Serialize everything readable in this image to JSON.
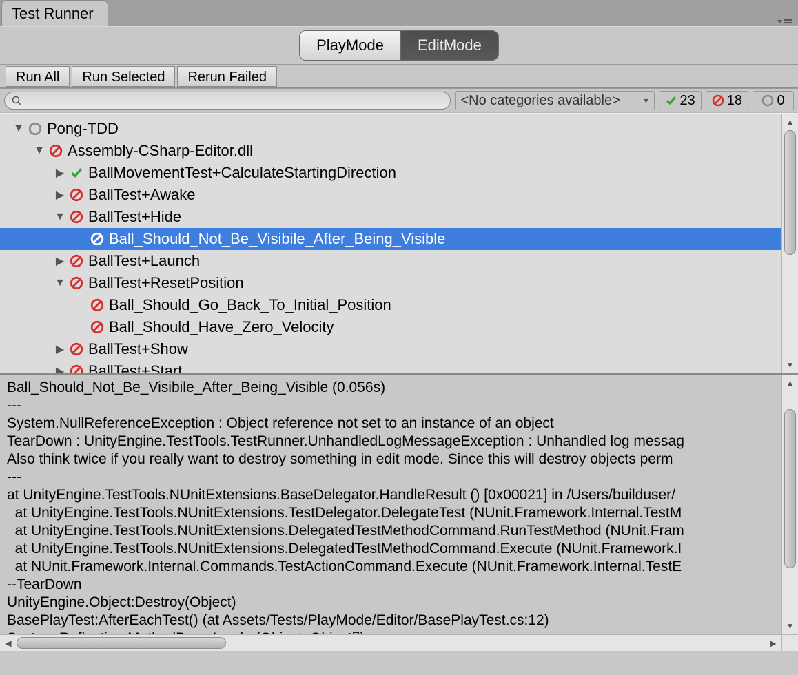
{
  "window": {
    "title": "Test Runner"
  },
  "modes": {
    "play": "PlayMode",
    "edit": "EditMode",
    "active": "play"
  },
  "runButtons": {
    "runAll": "Run All",
    "runSelected": "Run Selected",
    "rerunFailed": "Rerun Failed"
  },
  "search": {
    "placeholder": ""
  },
  "categories": {
    "label": "<No categories available>"
  },
  "counts": {
    "pass": "23",
    "fail": "18",
    "pending": "0"
  },
  "tree": [
    {
      "indent": 0,
      "arrow": "down",
      "status": "neutral",
      "label": "Pong-TDD",
      "selected": false
    },
    {
      "indent": 1,
      "arrow": "down",
      "status": "fail",
      "label": "Assembly-CSharp-Editor.dll",
      "selected": false
    },
    {
      "indent": 2,
      "arrow": "right",
      "status": "pass",
      "label": "BallMovementTest+CalculateStartingDirection",
      "selected": false
    },
    {
      "indent": 2,
      "arrow": "right",
      "status": "fail",
      "label": "BallTest+Awake",
      "selected": false
    },
    {
      "indent": 2,
      "arrow": "down",
      "status": "fail",
      "label": "BallTest+Hide",
      "selected": false
    },
    {
      "indent": 3,
      "arrow": "none",
      "status": "fail",
      "label": "Ball_Should_Not_Be_Visibile_After_Being_Visible",
      "selected": true
    },
    {
      "indent": 2,
      "arrow": "right",
      "status": "fail",
      "label": "BallTest+Launch",
      "selected": false
    },
    {
      "indent": 2,
      "arrow": "down",
      "status": "fail",
      "label": "BallTest+ResetPosition",
      "selected": false
    },
    {
      "indent": 3,
      "arrow": "none",
      "status": "fail",
      "label": "Ball_Should_Go_Back_To_Initial_Position",
      "selected": false
    },
    {
      "indent": 3,
      "arrow": "none",
      "status": "fail",
      "label": "Ball_Should_Have_Zero_Velocity",
      "selected": false
    },
    {
      "indent": 2,
      "arrow": "right",
      "status": "fail",
      "label": "BallTest+Show",
      "selected": false
    },
    {
      "indent": 2,
      "arrow": "right",
      "status": "fail",
      "label": "BallTest+Start",
      "selected": false
    }
  ],
  "details": "Ball_Should_Not_Be_Visibile_After_Being_Visible (0.056s)\n---\nSystem.NullReferenceException : Object reference not set to an instance of an object\nTearDown : UnityEngine.TestTools.TestRunner.UnhandledLogMessageException : Unhandled log messag\nAlso think twice if you really want to destroy something in edit mode. Since this will destroy objects perm\n---\nat UnityEngine.TestTools.NUnitExtensions.BaseDelegator.HandleResult () [0x00021] in /Users/builduser/\n  at UnityEngine.TestTools.NUnitExtensions.TestDelegator.DelegateTest (NUnit.Framework.Internal.TestM\n  at UnityEngine.TestTools.NUnitExtensions.DelegatedTestMethodCommand.RunTestMethod (NUnit.Fram\n  at UnityEngine.TestTools.NUnitExtensions.DelegatedTestMethodCommand.Execute (NUnit.Framework.I\n  at NUnit.Framework.Internal.Commands.TestActionCommand.Execute (NUnit.Framework.Internal.TestE\n--TearDown\nUnityEngine.Object:Destroy(Object)\nBasePlayTest:AfterEachTest() (at Assets/Tests/PlayMode/Editor/BasePlayTest.cs:12)\nSystem.Reflection.MethodBase:Invoke(Object, Object[])"
}
